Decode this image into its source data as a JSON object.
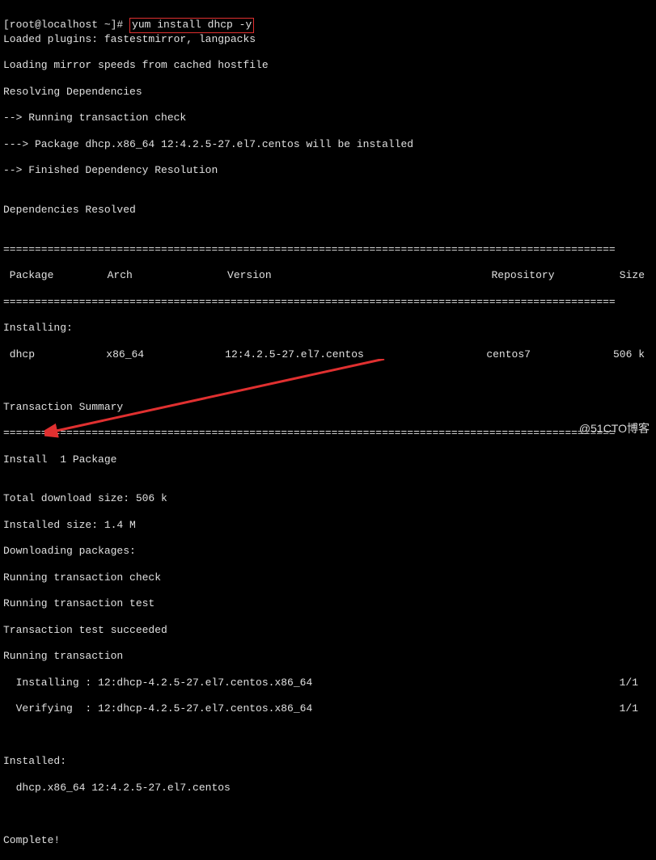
{
  "prompt": {
    "prefix": "[root@localhost ~]# ",
    "command": "yum install dhcp -y"
  },
  "preamble": [
    "Loaded plugins: fastestmirror, langpacks",
    "Loading mirror speeds from cached hostfile",
    "Resolving Dependencies",
    "--> Running transaction check",
    "---> Package dhcp.x86_64 12:4.2.5-27.el7.centos will be installed",
    "--> Finished Dependency Resolution",
    "",
    "Dependencies Resolved",
    ""
  ],
  "headers": {
    "package": " Package",
    "arch": "Arch",
    "version": "Version",
    "repository": "Repository",
    "size": "Size"
  },
  "installing_label": "Installing:",
  "pkgrow": {
    "name": " dhcp",
    "arch": "x86_64",
    "version": "12:4.2.5-27.el7.centos",
    "repo": "centos7",
    "size": "506 k"
  },
  "transaction_summary": "Transaction Summary",
  "install_count": "Install  1 Package",
  "details": [
    "",
    "Total download size: 506 k",
    "Installed size: 1.4 M",
    "Downloading packages:",
    "Running transaction check",
    "Running transaction test",
    "Transaction test succeeded",
    "Running transaction"
  ],
  "tx_install": "  Installing : 12:dhcp-4.2.5-27.el7.centos.x86_64",
  "tx_verify": "  Verifying  : 12:dhcp-4.2.5-27.el7.centos.x86_64",
  "tx_counter": "1/1",
  "installed_label": "Installed:",
  "installed_pkg": "  dhcp.x86_64 12:4.2.5-27.el7.centos",
  "complete": "Complete!",
  "watermark": "@51CTO博客",
  "ruleline": "================================================================================================="
}
